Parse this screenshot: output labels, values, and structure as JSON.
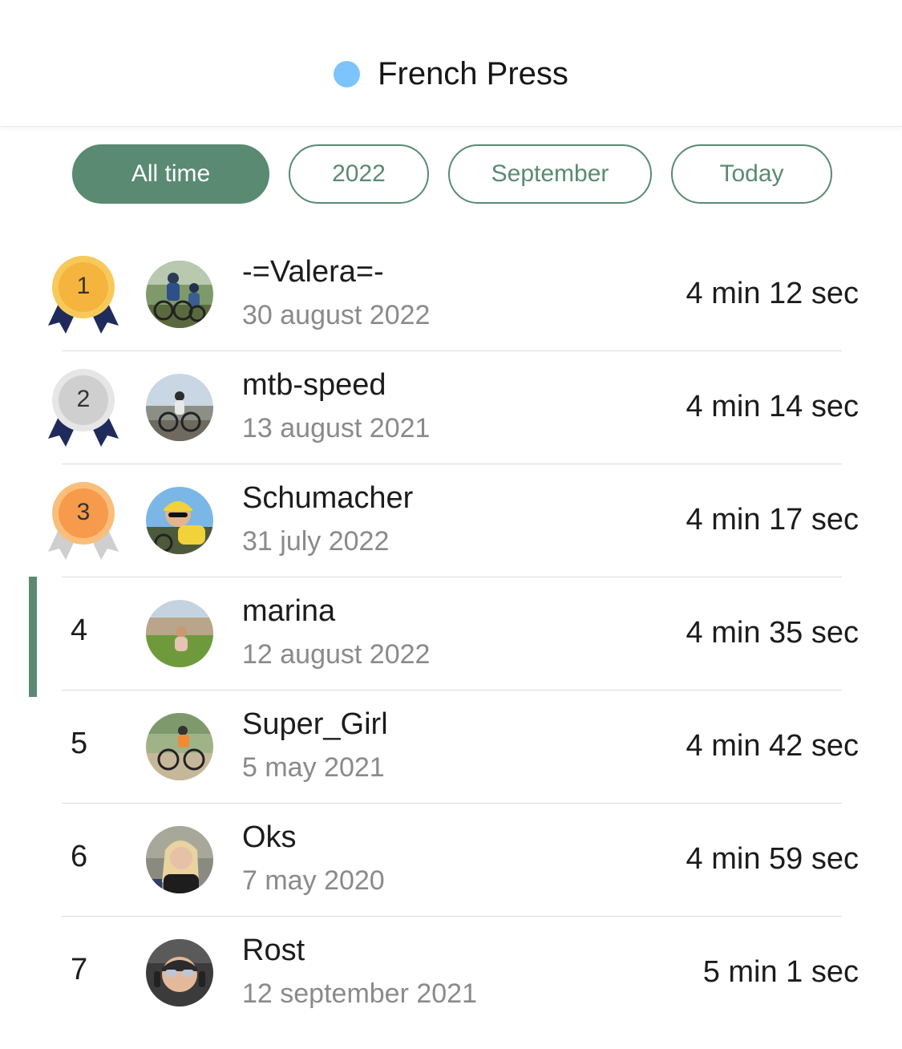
{
  "header": {
    "title": "French Press",
    "dot_color": "#7cc4fb"
  },
  "filters": [
    {
      "label": "All time",
      "active": true
    },
    {
      "label": "2022",
      "active": false
    },
    {
      "label": "September",
      "active": false
    },
    {
      "label": "Today",
      "active": false
    }
  ],
  "leaderboard": [
    {
      "rank": "1",
      "medal": "gold",
      "name": "-=Valera=-",
      "date": "30 august 2022",
      "time": "4 min 12 sec",
      "avatar": "cyclists-avatar"
    },
    {
      "rank": "2",
      "medal": "silver",
      "name": "mtb-speed",
      "date": "13 august 2021",
      "time": "4 min 14 sec",
      "avatar": "rider-avatar"
    },
    {
      "rank": "3",
      "medal": "bronze",
      "name": "Schumacher",
      "date": "31 july 2022",
      "time": "4 min 17 sec",
      "avatar": "yellow-helmet-avatar"
    },
    {
      "rank": "4",
      "medal": "none",
      "highlighted": true,
      "name": "marina",
      "date": "12 august 2022",
      "time": "4 min 35 sec",
      "avatar": "grass-avatar"
    },
    {
      "rank": "5",
      "medal": "none",
      "name": "Super_Girl",
      "date": "5 may 2021",
      "time": "4 min 42 sec",
      "avatar": "bike-avatar"
    },
    {
      "rank": "6",
      "medal": "none",
      "name": "Oks",
      "date": "7 may 2020",
      "time": "4 min 59 sec",
      "avatar": "portrait-avatar"
    },
    {
      "rank": "7",
      "medal": "none",
      "name": "Rost",
      "date": "12 september 2021",
      "time": "5 min 1 sec",
      "avatar": "sunglasses-avatar"
    }
  ],
  "colors": {
    "accent": "#5a8a72",
    "gold": "#f5b43e",
    "silver": "#d0d0d0",
    "bronze": "#f79a4c",
    "ribbon_dark": "#1f2b5a",
    "ribbon_light": "#cfcfcf"
  }
}
